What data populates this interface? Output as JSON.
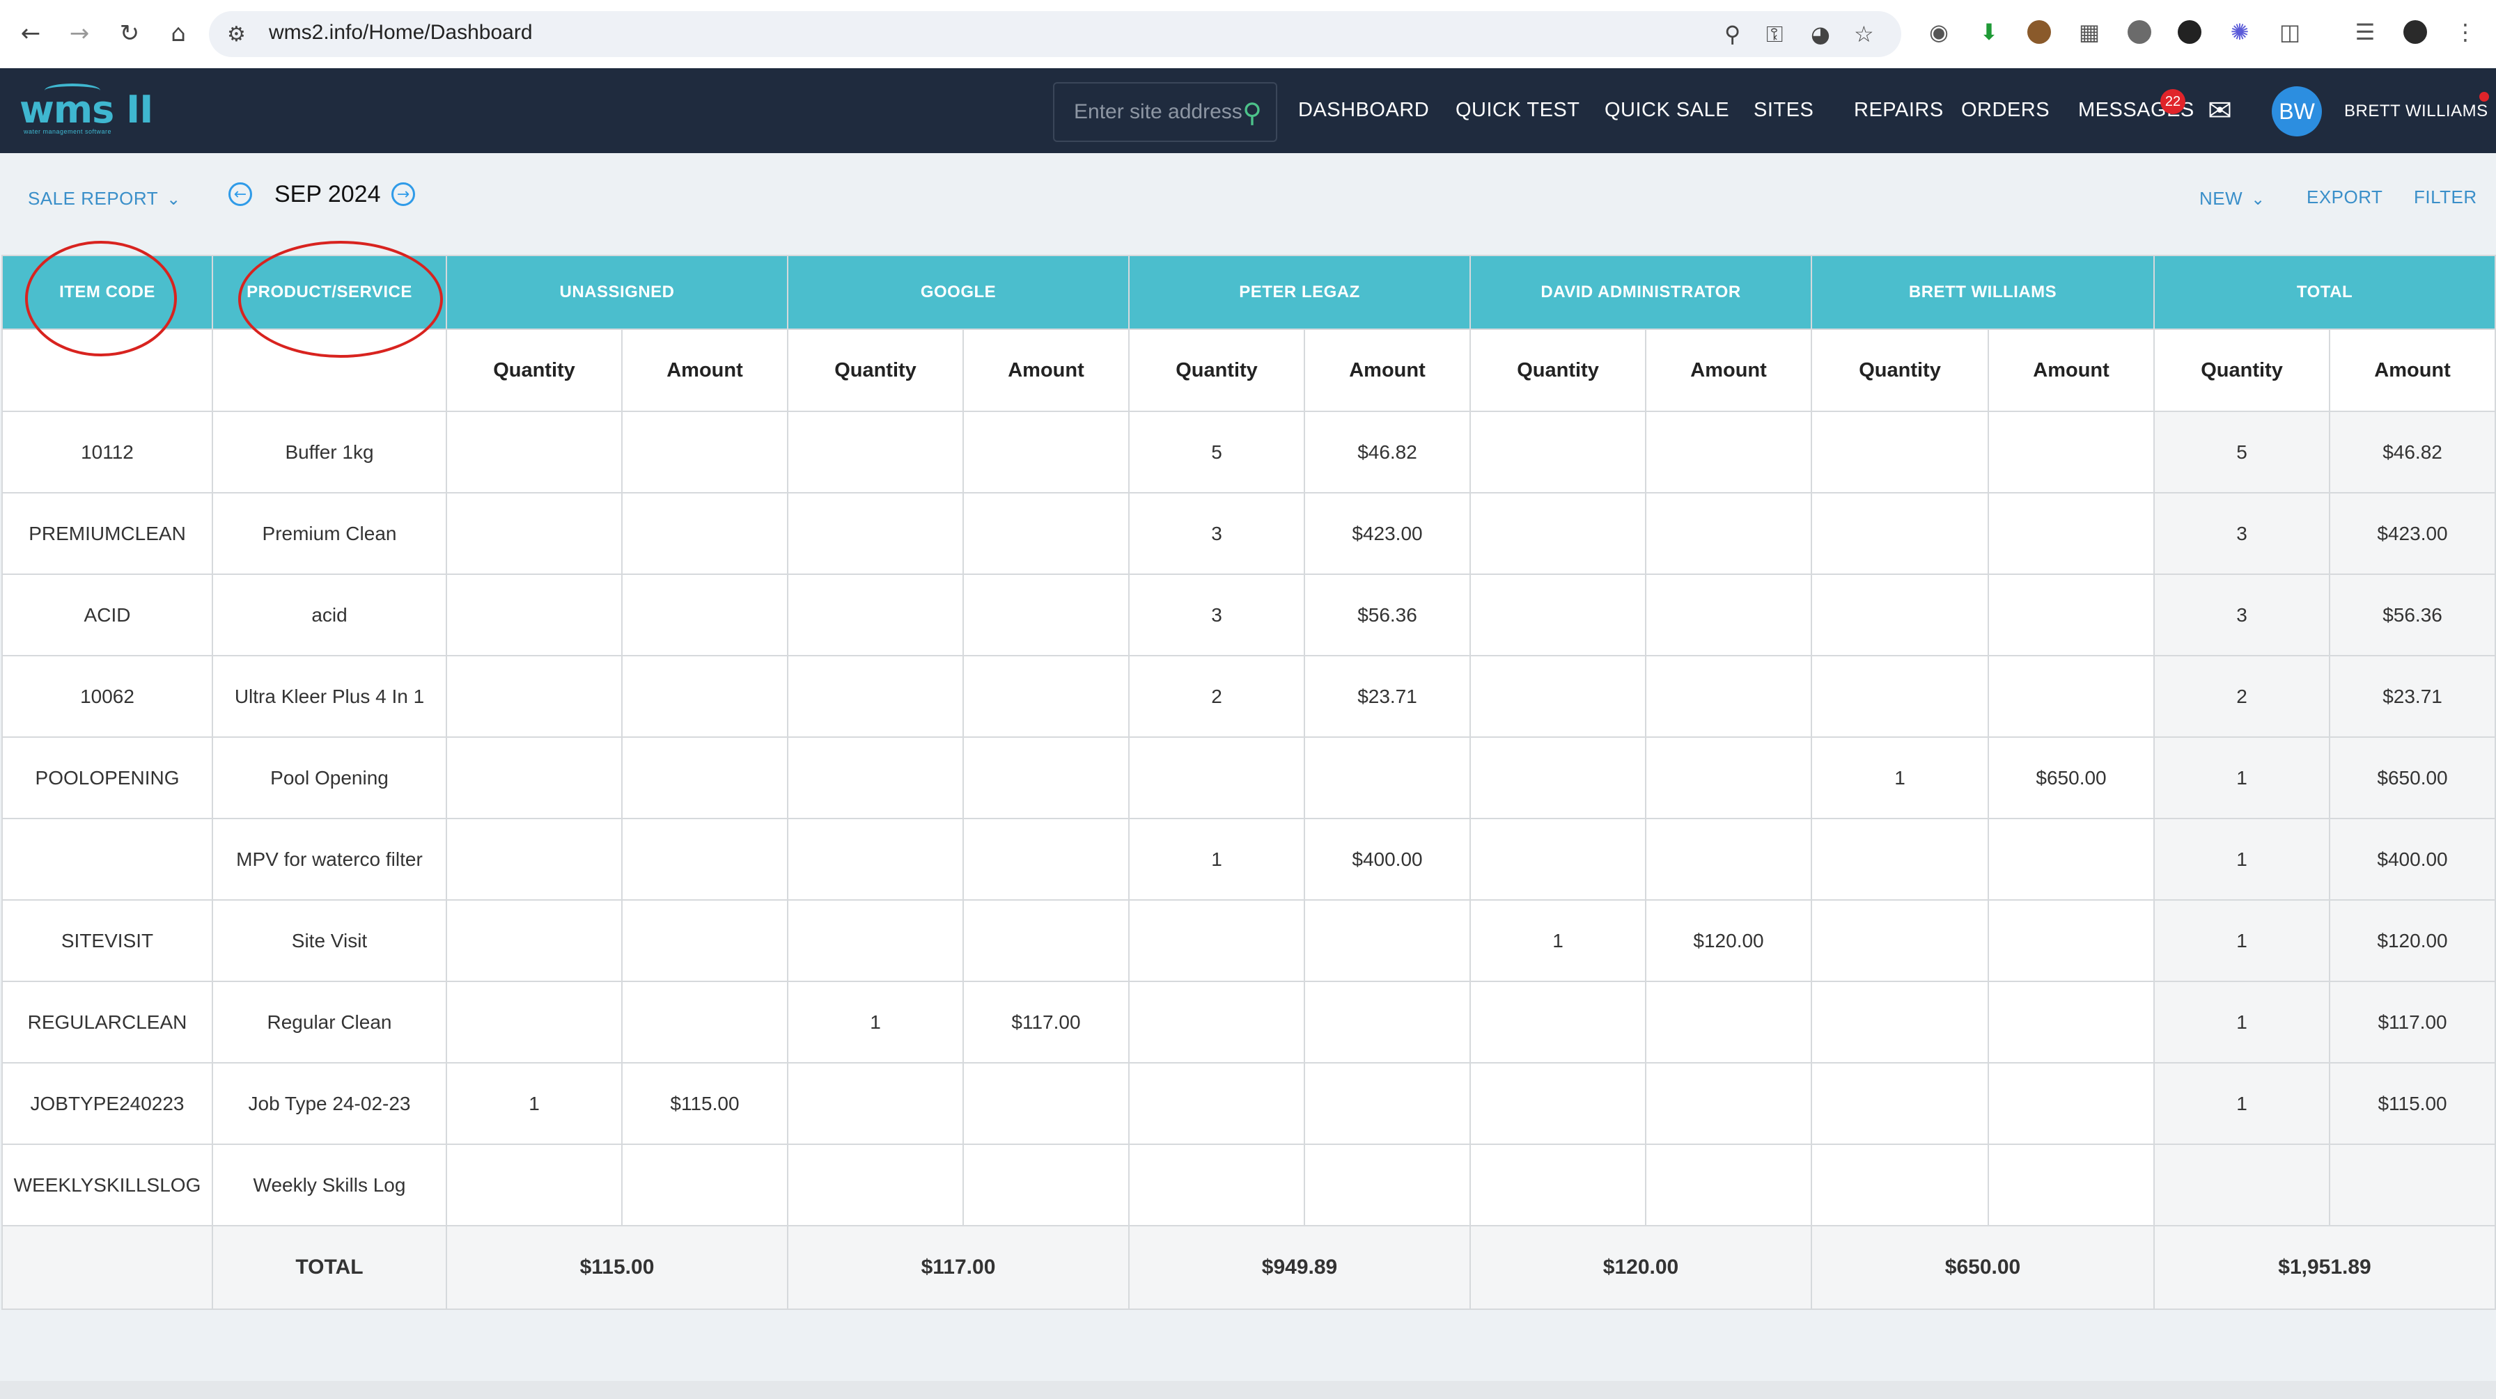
{
  "browser": {
    "url": "wms2.info/Home/Dashboard"
  },
  "app": {
    "logo_text": "wms II",
    "logo_subtitle": "water management software",
    "search_placeholder": "Enter site address",
    "nav": [
      "DASHBOARD",
      "QUICK TEST",
      "QUICK SALE",
      "SITES",
      "REPAIRS",
      "ORDERS",
      "MESSAGES"
    ],
    "messages_badge": "22",
    "user_initials": "BW",
    "user_name": "BRETT WILLIAMS"
  },
  "toolbar": {
    "report_selector": "SALE REPORT",
    "month": "SEP 2024",
    "new_label": "NEW",
    "export_label": "EXPORT",
    "filter_label": "FILTER"
  },
  "table": {
    "headers": {
      "item_code": "ITEM CODE",
      "product": "PRODUCT/SERVICE",
      "groups": [
        "UNASSIGNED",
        "GOOGLE",
        "PETER LEGAZ",
        "DAVID ADMINISTRATOR",
        "BRETT WILLIAMS",
        "TOTAL"
      ],
      "quantity": "Quantity",
      "amount": "Amount"
    },
    "rows": [
      {
        "code": "10112",
        "product": "Buffer 1kg",
        "cells": [
          "",
          "",
          "",
          "",
          "5",
          "$46.82",
          "",
          "",
          "",
          "",
          "5",
          "$46.82"
        ]
      },
      {
        "code": "PREMIUMCLEAN",
        "product": "Premium Clean",
        "cells": [
          "",
          "",
          "",
          "",
          "3",
          "$423.00",
          "",
          "",
          "",
          "",
          "3",
          "$423.00"
        ]
      },
      {
        "code": "ACID",
        "product": "acid",
        "cells": [
          "",
          "",
          "",
          "",
          "3",
          "$56.36",
          "",
          "",
          "",
          "",
          "3",
          "$56.36"
        ]
      },
      {
        "code": "10062",
        "product": "Ultra Kleer Plus 4 In 1",
        "cells": [
          "",
          "",
          "",
          "",
          "2",
          "$23.71",
          "",
          "",
          "",
          "",
          "2",
          "$23.71"
        ]
      },
      {
        "code": "POOLOPENING",
        "product": "Pool Opening",
        "cells": [
          "",
          "",
          "",
          "",
          "",
          "",
          "",
          "",
          "1",
          "$650.00",
          "1",
          "$650.00"
        ]
      },
      {
        "code": "",
        "product": "MPV for waterco filter",
        "cells": [
          "",
          "",
          "",
          "",
          "1",
          "$400.00",
          "",
          "",
          "",
          "",
          "1",
          "$400.00"
        ]
      },
      {
        "code": "SITEVISIT",
        "product": "Site Visit",
        "cells": [
          "",
          "",
          "",
          "",
          "",
          "",
          "1",
          "$120.00",
          "",
          "",
          "1",
          "$120.00"
        ]
      },
      {
        "code": "REGULARCLEAN",
        "product": "Regular Clean",
        "cells": [
          "",
          "",
          "1",
          "$117.00",
          "",
          "",
          "",
          "",
          "",
          "",
          "1",
          "$117.00"
        ]
      },
      {
        "code": "JOBTYPE240223",
        "product": "Job Type 24-02-23",
        "cells": [
          "1",
          "$115.00",
          "",
          "",
          "",
          "",
          "",
          "",
          "",
          "",
          "1",
          "$115.00"
        ]
      },
      {
        "code": "WEEKLYSKILLSLOG",
        "product": "Weekly Skills Log",
        "cells": [
          "",
          "",
          "",
          "",
          "",
          "",
          "",
          "",
          "",
          "",
          "",
          ""
        ]
      }
    ],
    "total_label": "TOTAL",
    "totals": [
      "$115.00",
      "$117.00",
      "$949.89",
      "$120.00",
      "$650.00",
      "$1,951.89"
    ]
  },
  "colors": {
    "header_bg": "#1f2b3e",
    "table_header": "#4bbecd",
    "link": "#3a8fc9",
    "annotation": "#d8231f"
  }
}
